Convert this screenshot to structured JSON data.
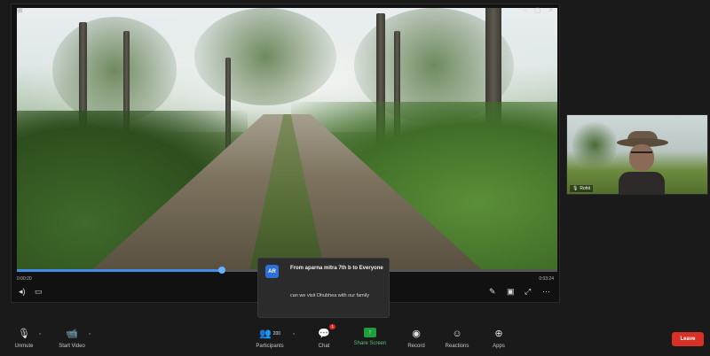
{
  "shared_video": {
    "time_current": "0:00:20",
    "time_total": "0:03:24",
    "progress_fraction": 0.38
  },
  "participant": {
    "name": "Rohit"
  },
  "chat_popup": {
    "avatar_initials": "AR",
    "header": "From aparna mitra 7th b to Everyone",
    "message": "can we visit Dhubhea with our family"
  },
  "toolbar": {
    "mute_label": "Unmute",
    "video_label": "Start Video",
    "participants_label": "Participants",
    "participants_count": "200",
    "chat_label": "Chat",
    "chat_badge": "1",
    "share_label": "Share Screen",
    "record_label": "Record",
    "reactions_label": "Reactions",
    "apps_label": "Apps",
    "end_label": "Leave"
  },
  "colors": {
    "accent": "#3e8ee9",
    "share_green": "#1f9e3c",
    "end_red": "#d93025"
  }
}
